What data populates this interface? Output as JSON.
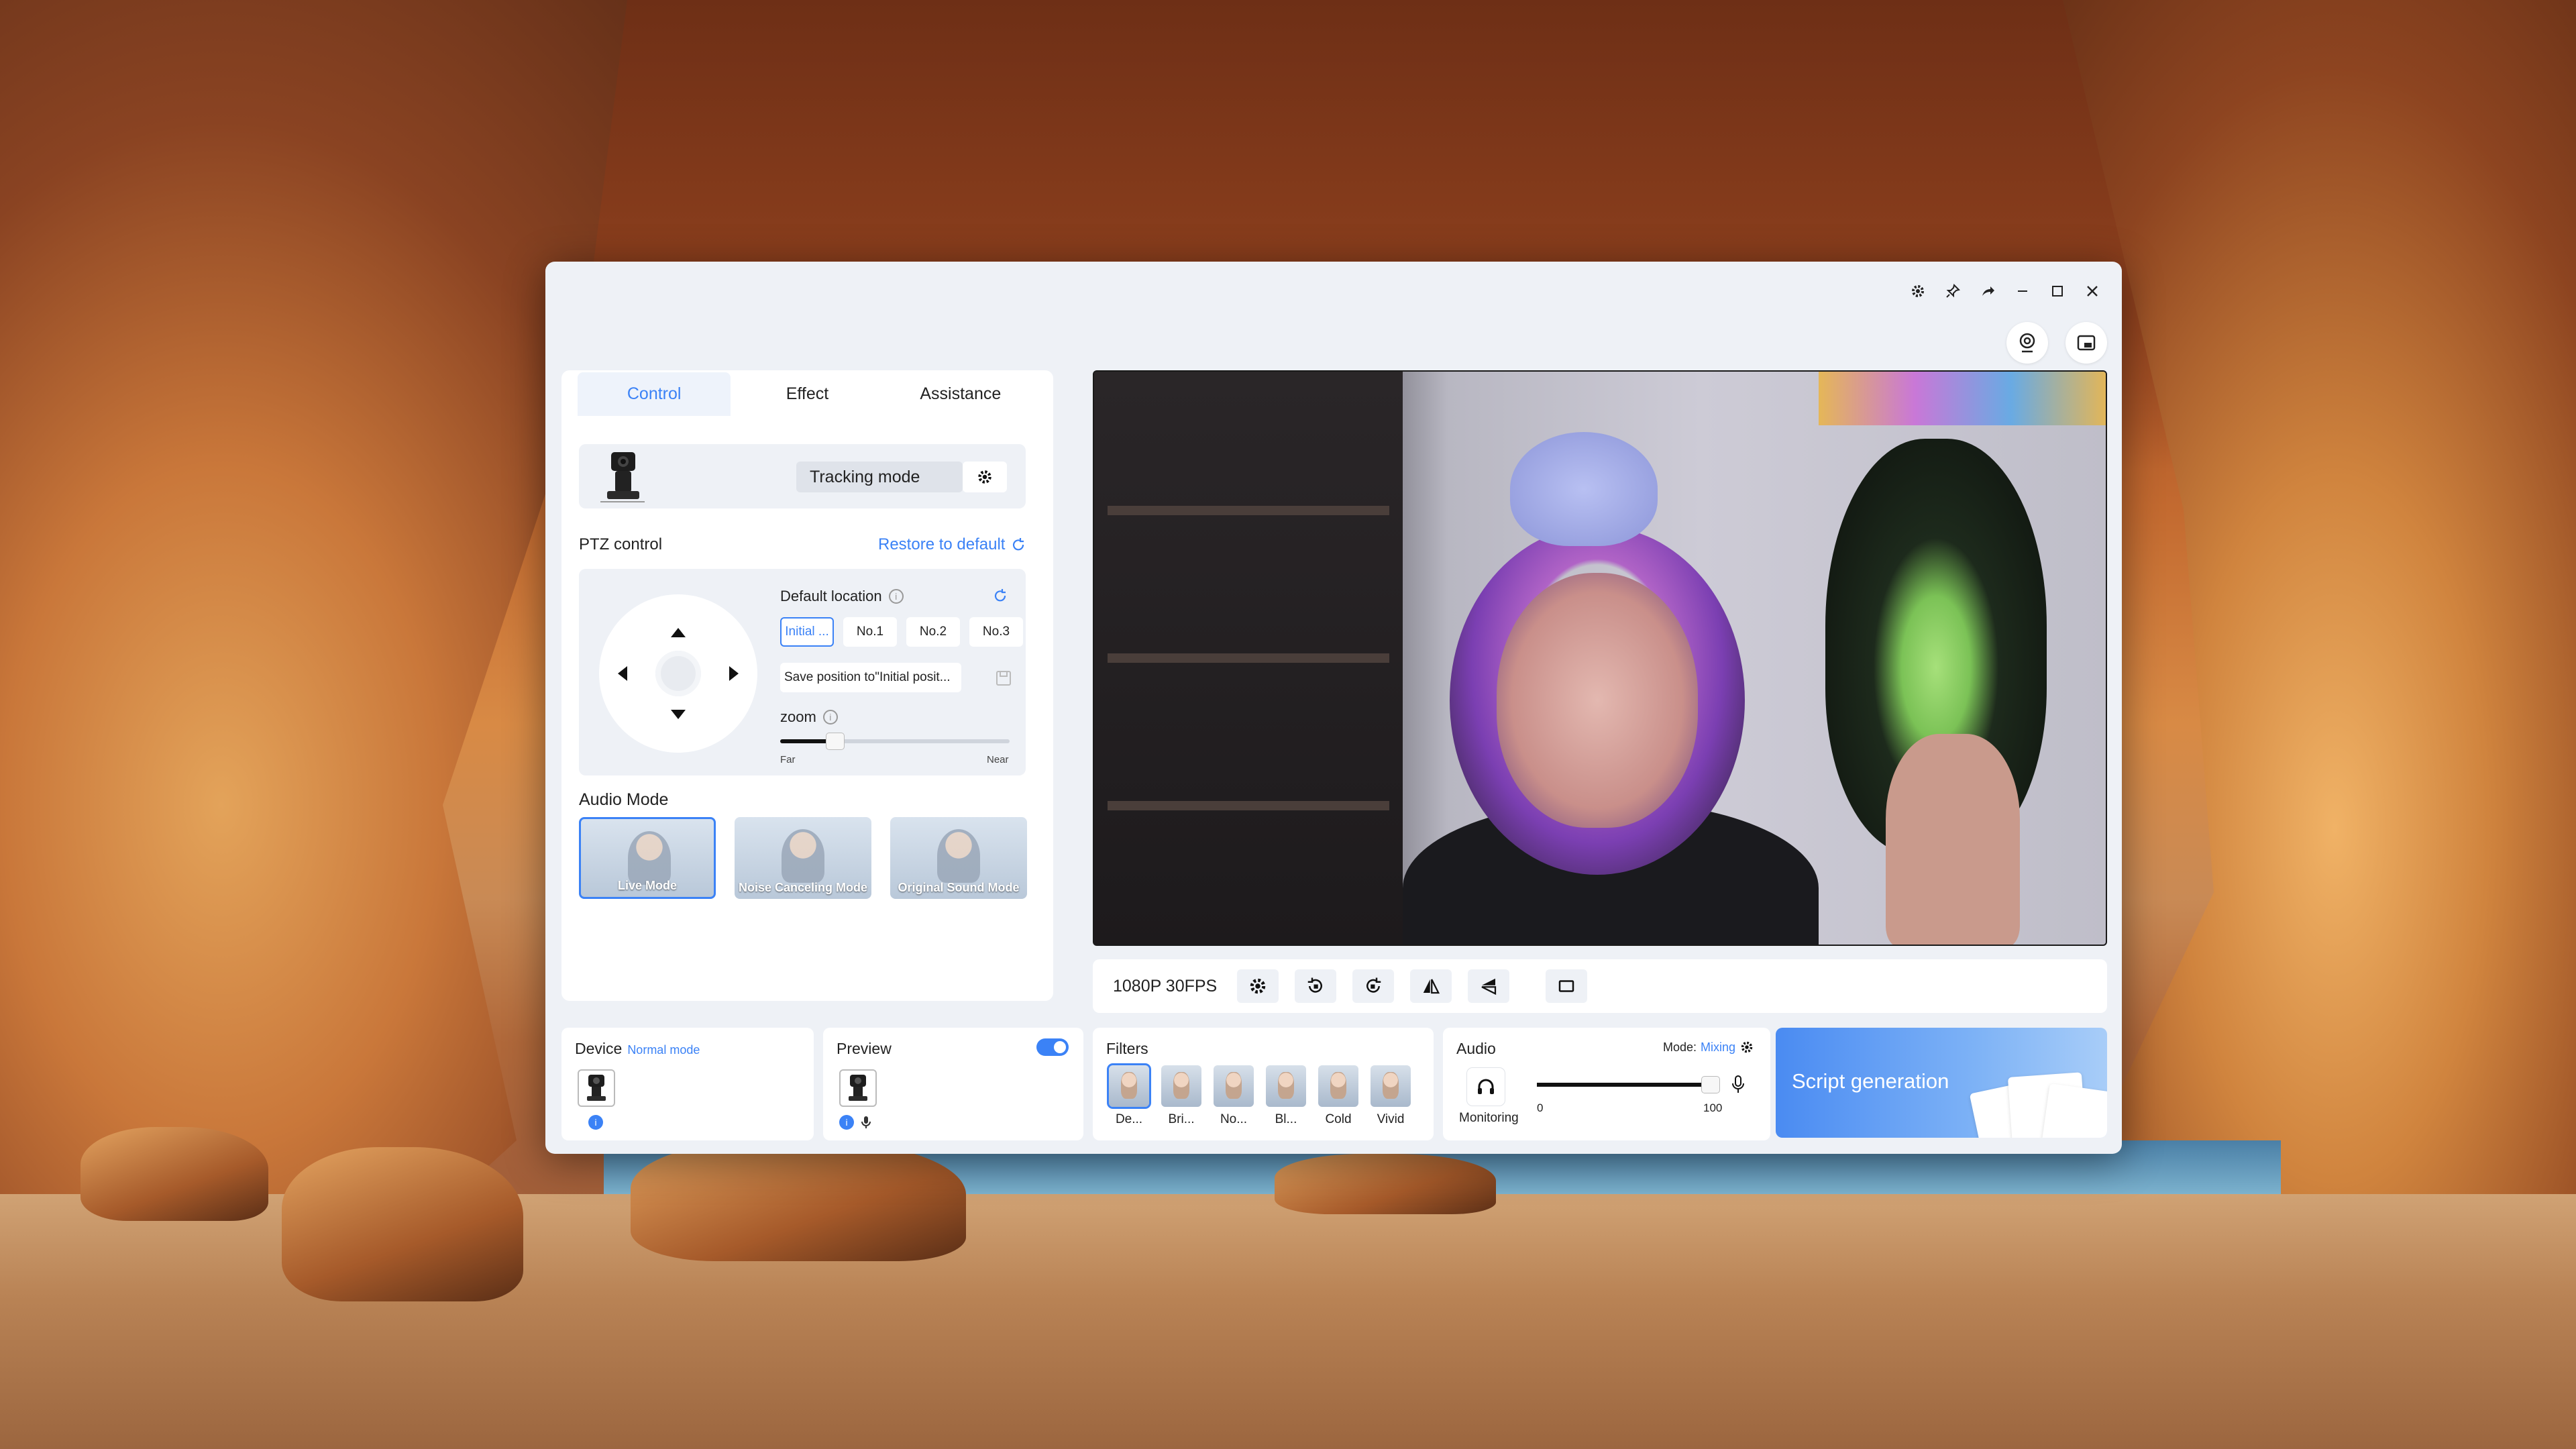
{
  "window": {
    "title_icons": [
      "settings-icon",
      "pin-icon",
      "share-icon",
      "minimize-icon",
      "maximize-icon",
      "close-icon"
    ]
  },
  "tabs": [
    {
      "label": "Control",
      "active": true
    },
    {
      "label": "Effect",
      "active": false
    },
    {
      "label": "Assistance",
      "active": false
    }
  ],
  "tracking": {
    "mode_label": "Tracking mode"
  },
  "ptz": {
    "title": "PTZ control",
    "restore_label": "Restore to default",
    "default_location_label": "Default location",
    "locations": [
      "Initial ...",
      "No.1",
      "No.2",
      "No.3"
    ],
    "selected_location": 0,
    "save_position_label": "Save position to\"Initial posit...",
    "zoom_label": "zoom",
    "zoom_level": 0.24,
    "far_label": "Far",
    "near_label": "Near"
  },
  "audio_mode": {
    "title": "Audio Mode",
    "modes": [
      "Live Mode",
      "Noise Canceling Mode",
      "Original Sound Mode"
    ],
    "selected": 0
  },
  "video_controls": {
    "resolution": "1080P 30FPS"
  },
  "device": {
    "title": "Device",
    "mode": "Normal mode"
  },
  "preview": {
    "title": "Preview",
    "enabled": true
  },
  "filters": {
    "title": "Filters",
    "items": [
      "De...",
      "Bri...",
      "No...",
      "Bl...",
      "Cold",
      "Vivid"
    ],
    "selected": 0
  },
  "audio": {
    "title": "Audio",
    "mode_label": "Mode:",
    "mode_value": "Mixing",
    "monitoring_label": "Monitoring",
    "volume_min": "0",
    "volume_max": "100",
    "volume": 0.96
  },
  "script": {
    "label": "Script generation"
  },
  "colors": {
    "accent": "#3b82f6",
    "panel": "#eef1f6"
  }
}
